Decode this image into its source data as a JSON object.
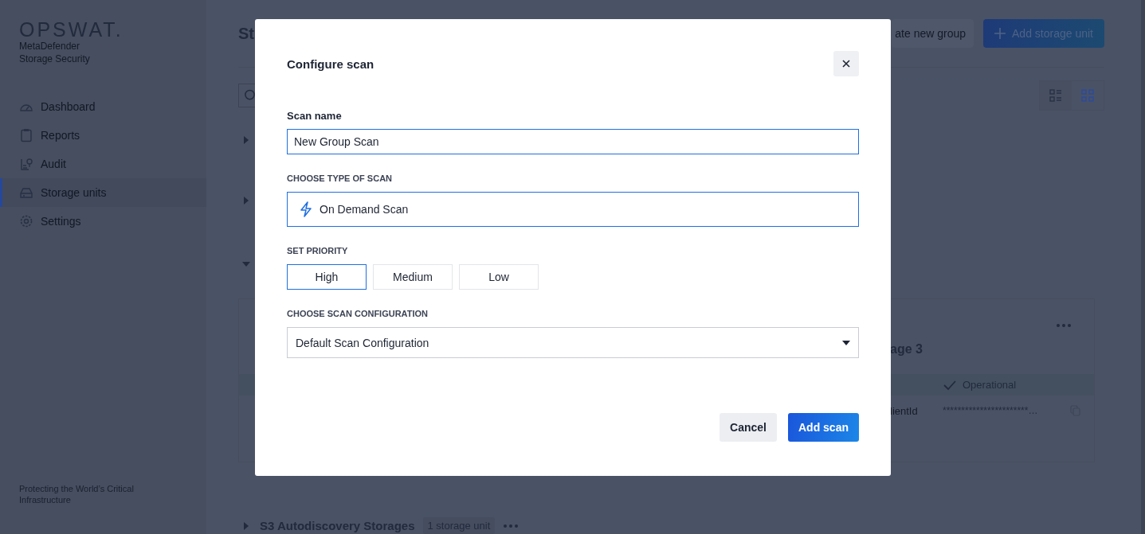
{
  "sidebar": {
    "logo": "OPSWAT.",
    "product_lines": [
      "MetaDefender",
      "Storage Security"
    ],
    "items": [
      {
        "kind": "dashboard",
        "label": "Dashboard",
        "selected": false
      },
      {
        "kind": "reports",
        "label": "Reports",
        "selected": false
      },
      {
        "kind": "audit",
        "label": "Audit",
        "selected": false
      },
      {
        "kind": "storage",
        "label": "Storage units",
        "selected": true
      },
      {
        "kind": "settings",
        "label": "Settings",
        "selected": false
      }
    ],
    "footer": "Protecting the World’s Critical Infrastructure"
  },
  "page": {
    "title": "St",
    "create_group_button": "ate new group",
    "add_button": "Add storage unit",
    "view_modes": [
      {
        "kind": "list",
        "selected": false
      },
      {
        "kind": "grid",
        "selected": true
      }
    ],
    "groups": [
      {
        "expanded": false
      },
      {
        "expanded": false
      },
      {
        "expanded": true,
        "card": {
          "title": "age 3",
          "status": "Operational",
          "field_label": "lientId",
          "field_value": "***********************…"
        }
      },
      {
        "expanded": false,
        "name": "S3 Autodiscovery Storages",
        "count": "1 storage unit"
      }
    ]
  },
  "dialog": {
    "title": "Configure scan",
    "name_label": "Scan name",
    "name_value": "New Group Scan",
    "type_label": "CHOOSE TYPE OF SCAN",
    "scan_type": "On Demand Scan",
    "priority_label": "SET PRIORITY",
    "priorities": [
      {
        "label": "High",
        "selected": true
      },
      {
        "label": "Medium",
        "selected": false
      },
      {
        "label": "Low",
        "selected": false
      }
    ],
    "config_label": "CHOOSE SCAN CONFIGURATION",
    "config_value": "Default Scan Configuration",
    "buttons": [
      {
        "kind": "secondary",
        "label": "Cancel"
      },
      {
        "kind": "primary",
        "label": "Add scan"
      }
    ]
  }
}
